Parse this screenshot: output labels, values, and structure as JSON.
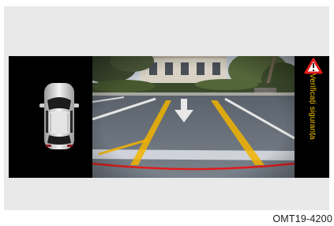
{
  "screen": {
    "warning_label": "Verificați siguranța",
    "warning_icon": "warning-triangle-icon",
    "colors": {
      "guide_yellow": "#f2b400",
      "guide_red": "#e01c1c",
      "warning_text": "#f5c400"
    }
  },
  "caption": "OMT19-4200"
}
